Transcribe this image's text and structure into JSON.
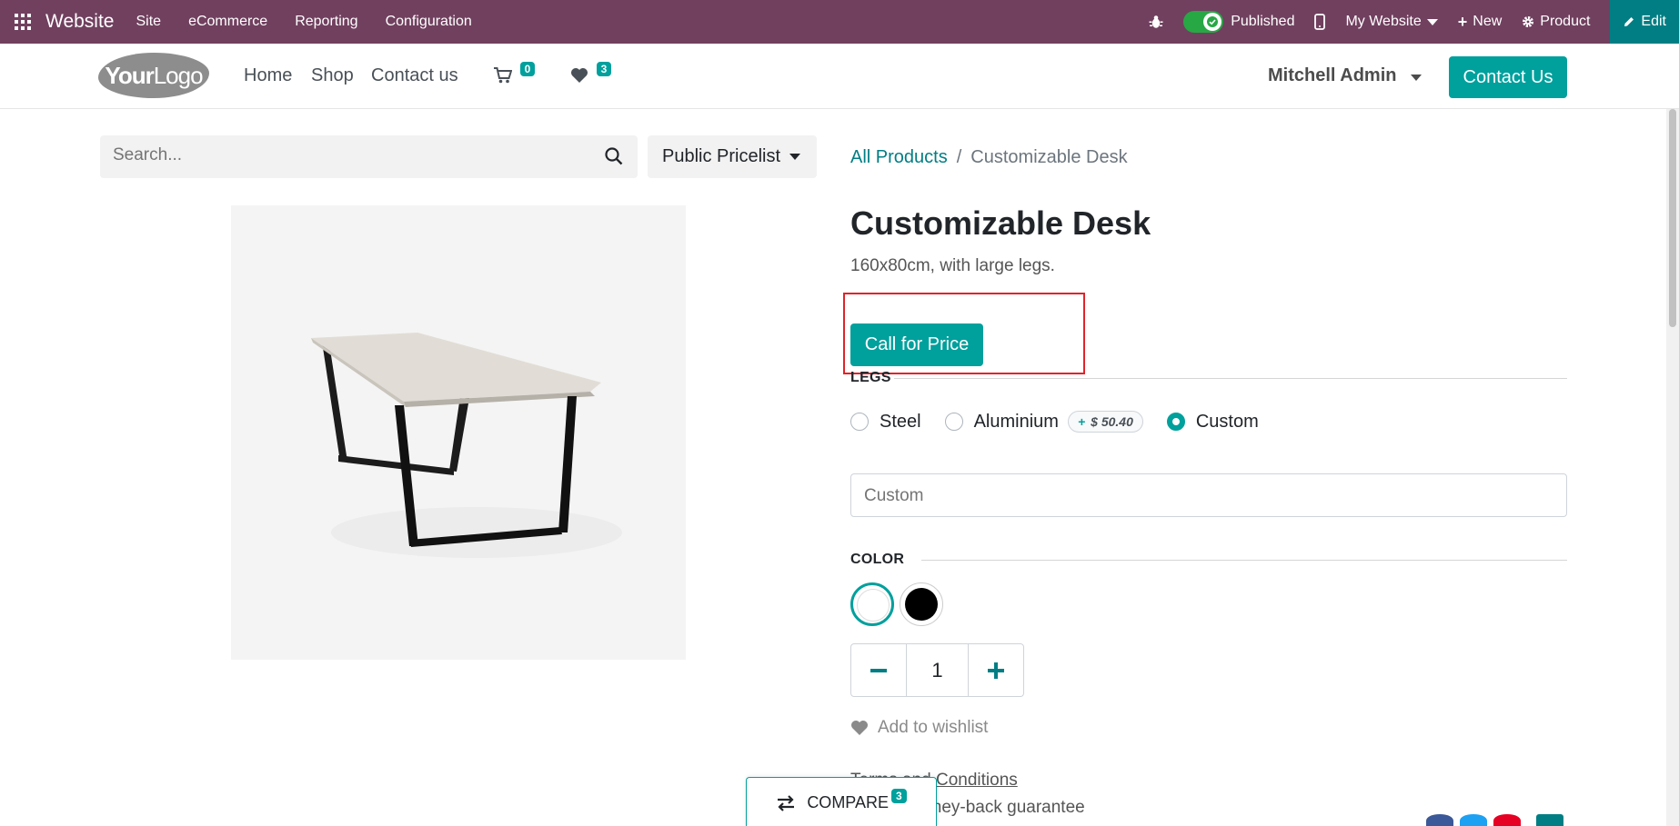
{
  "topbar": {
    "brand": "Website",
    "menus": [
      "Site",
      "eCommerce",
      "Reporting",
      "Configuration"
    ],
    "published": "Published",
    "my_website": "My Website",
    "new": "New",
    "product": "Product",
    "edit": "Edit"
  },
  "header": {
    "logo_bold": "Your",
    "logo_light": "Logo",
    "nav": [
      "Home",
      "Shop",
      "Contact us"
    ],
    "cart_count": "0",
    "wishlist_count": "3",
    "user": "Mitchell Admin",
    "contact_button": "Contact Us"
  },
  "search": {
    "placeholder": "Search...",
    "pricelist": "Public Pricelist"
  },
  "breadcrumb": {
    "parent": "All Products",
    "separator": "/",
    "current": "Customizable Desk"
  },
  "product": {
    "name": "Customizable Desk",
    "description": "160x80cm, with large legs.",
    "call_for_price": "Call for Price",
    "legs_label": "LEGS",
    "leg_options": [
      {
        "label": "Steel",
        "checked": false
      },
      {
        "label": "Aluminium",
        "checked": false,
        "extra": "$ 50.40",
        "extra_sign": "+"
      },
      {
        "label": "Custom",
        "checked": true
      }
    ],
    "custom_placeholder": "Custom",
    "color_label": "COLOR",
    "colors": [
      "#ffffff",
      "#000000"
    ],
    "quantity": "1",
    "add_to_wishlist": "Add to wishlist",
    "terms_prefix": "Terms and ",
    "terms_link": "Conditions",
    "guarantee": "30-day money-back guarantee"
  },
  "compare": {
    "label": "COMPARE",
    "count": "3"
  },
  "colors": {
    "admin_bar": "#71405f",
    "primary": "#00a09d",
    "edit": "#017e84",
    "highlight": "#e0232a"
  }
}
